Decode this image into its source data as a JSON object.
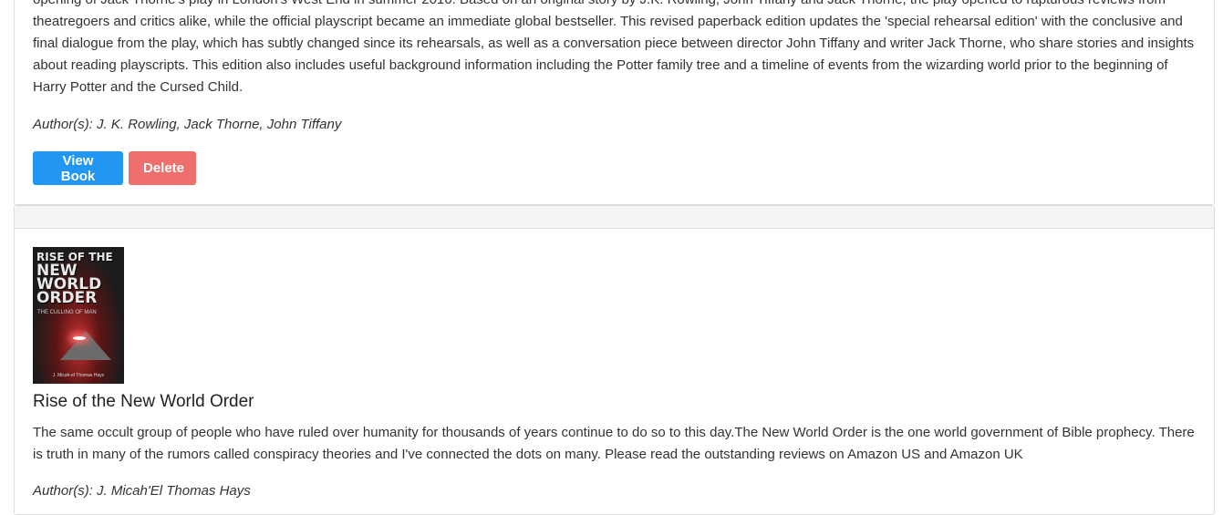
{
  "books": [
    {
      "description": "opening of Jack Thorne's play in London's West End in summer 2016. Based on an original story by J.K. Rowling, John Tiffany and Jack Thorne, the play opened to rapturous reviews from theatregoers and critics alike, while the official playscript became an immediate global bestseller. This revised paperback edition updates the 'special rehearsal edition' with the conclusive and final dialogue from the play, which has subtly changed since its rehearsals, as well as a conversation piece between director John Tiffany and writer Jack Thorne, who share stories and insights about reading playscripts. This edition also includes useful background information including the Potter family tree and a timeline of events from the wizarding world prior to the beginning of Harry Potter and the Cursed Child.",
      "authors": "Author(s): J. K. Rowling, Jack Thorne, John Tiffany",
      "view_label": "View Book",
      "delete_label": "Delete"
    },
    {
      "title": "Rise of the New World Order",
      "cover": {
        "line1": "RISE OF THE",
        "line2": "NEW",
        "line3": "WORLD",
        "line4": "ORDER",
        "subtitle": "THE CULLING OF MAN",
        "author": "J. Micah-el Thomas Hays"
      },
      "description": "The same occult group of people who have ruled over humanity for thousands of years continue to do so to this day.The New World Order is the one world government of Bible prophecy. There is truth in many of the rumors called conspiracy theories and I've connected the dots on many. Please read the outstanding reviews on Amazon US and Amazon UK",
      "authors": "Author(s): J. Micah'El Thomas Hays"
    }
  ],
  "colors": {
    "view_button": "#2196f3",
    "delete_button": "#ef6f6c",
    "card_header": "#f5f5f5"
  }
}
